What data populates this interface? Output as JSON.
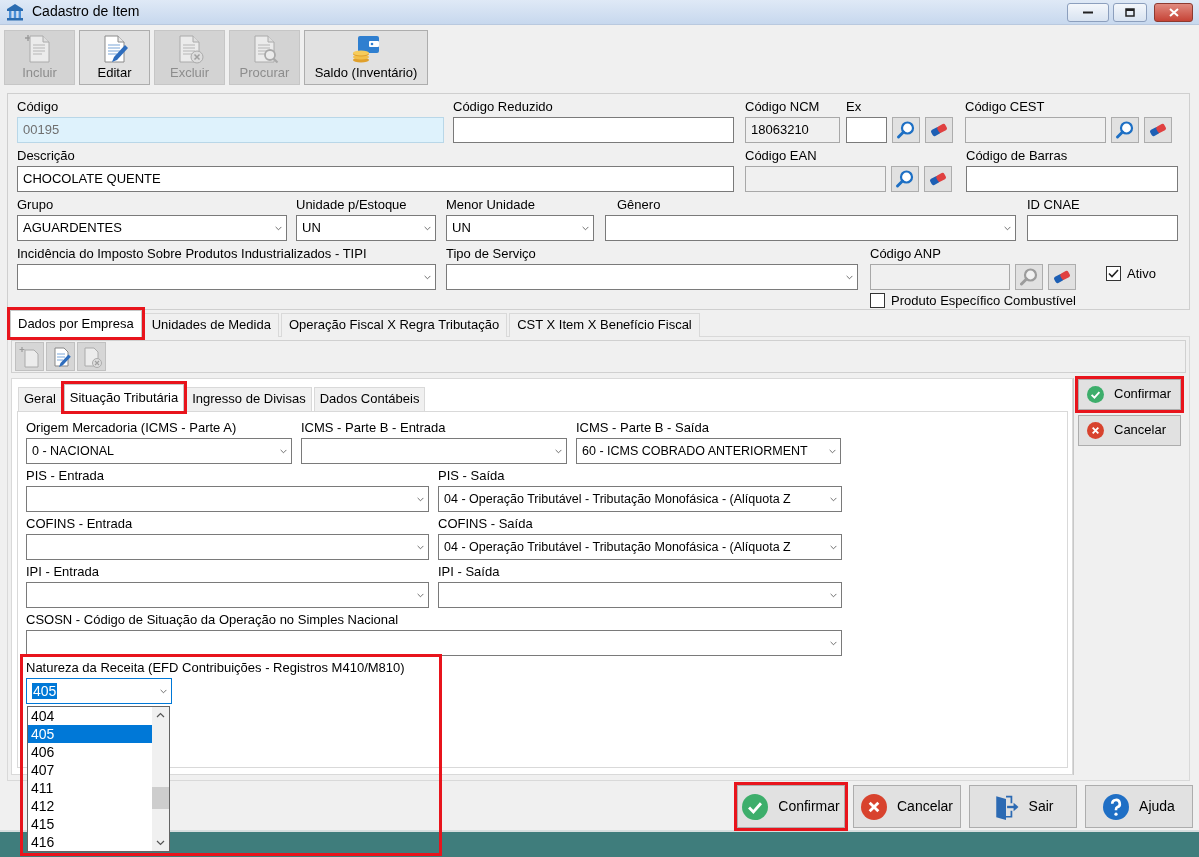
{
  "window": {
    "title": "Cadastro de Item"
  },
  "toolbar": [
    {
      "kind": "add",
      "label": "Incluir",
      "disabled": true
    },
    {
      "kind": "edit",
      "label": "Editar",
      "disabled": false
    },
    {
      "kind": "delete",
      "label": "Excluir",
      "disabled": true
    },
    {
      "kind": "search",
      "label": "Procurar",
      "disabled": true
    },
    {
      "kind": "balance",
      "label": "Saldo (Inventário)",
      "disabled": false
    }
  ],
  "item_form": {
    "fields": [
      {
        "kind": "text",
        "label": "Código",
        "value": "00195",
        "readonly": true,
        "disabled": false
      },
      {
        "kind": "text",
        "label": "Código Reduzido",
        "readonly": false,
        "disabled": false
      },
      {
        "kind": "text",
        "label": "Código NCM",
        "value": "18063210",
        "readonly": false,
        "disabled": true
      },
      {
        "kind": "lookup",
        "label": "Ex",
        "readonly": false,
        "disabled": false,
        "search_disabled": false
      },
      {
        "kind": "lookup",
        "label": "Código CEST",
        "readonly": false,
        "disabled": true,
        "search_disabled": false
      },
      {
        "kind": "text",
        "label": "Descrição",
        "value": "CHOCOLATE QUENTE",
        "readonly": false,
        "disabled": false
      },
      {
        "kind": "lookup",
        "label": "Código EAN",
        "readonly": false,
        "disabled": true,
        "search_disabled": false
      },
      {
        "kind": "text",
        "label": "Código de Barras",
        "readonly": false,
        "disabled": false
      },
      {
        "kind": "select",
        "label": "Grupo",
        "value": "AGUARDENTES"
      },
      {
        "kind": "select",
        "label": "Unidade p/Estoque",
        "value": "UN"
      },
      {
        "kind": "select",
        "label": "Menor Unidade",
        "value": "UN"
      },
      {
        "kind": "select",
        "label": "Gênero"
      },
      {
        "kind": "text",
        "label": "ID CNAE",
        "readonly": false,
        "disabled": false
      },
      {
        "kind": "select",
        "label": "Incidência do Imposto Sobre Produtos Industrializados - TIPI"
      },
      {
        "kind": "select",
        "label": "Tipo de Serviço"
      },
      {
        "kind": "lookup",
        "label": "Código ANP",
        "readonly": false,
        "disabled": true,
        "search_disabled": true
      },
      {
        "kind": "checkbox",
        "label": "Ativo",
        "checked": true
      },
      {
        "kind": "checkbox",
        "label": "Produto Específico Combustível",
        "checked": false
      }
    ]
  },
  "tabs": [
    {
      "label": "Dados por Empresa",
      "selected": true,
      "highlighted": true
    },
    {
      "label": "Unidades de Medida",
      "selected": false,
      "highlighted": false
    },
    {
      "label": "Operação Fiscal X Regra Tributação",
      "selected": false,
      "highlighted": false
    },
    {
      "label": "CST X Item X Benefício Fiscal",
      "selected": false,
      "highlighted": false
    }
  ],
  "sub_toolbar": [
    {
      "kind": "add",
      "disabled": true
    },
    {
      "kind": "edit",
      "disabled": false
    },
    {
      "kind": "delete",
      "disabled": true
    }
  ],
  "subtabs": [
    {
      "label": "Geral",
      "selected": false,
      "highlighted": false
    },
    {
      "label": "Situação Tributária",
      "selected": true,
      "highlighted": true
    },
    {
      "label": "Ingresso de Divisas",
      "selected": false,
      "highlighted": false
    },
    {
      "label": "Dados Contábeis",
      "selected": false,
      "highlighted": false
    }
  ],
  "tax_form": {
    "rows": [
      [
        {
          "kind": "select",
          "label": "Origem Mercadoria (ICMS - Parte A)",
          "value": "0 - NACIONAL"
        },
        {
          "kind": "select",
          "label": "ICMS - Parte B - Entrada"
        },
        {
          "kind": "select",
          "label": "ICMS - Parte B - Saída",
          "value": "60 - ICMS COBRADO ANTERIORMENT"
        }
      ],
      [
        {
          "kind": "select",
          "label": "PIS - Entrada"
        },
        {
          "kind": "select",
          "label": "PIS - Saída",
          "value": "04 - Operação Tributável - Tributação Monofásica - (Alíquota Z"
        }
      ],
      [
        {
          "kind": "select",
          "label": "COFINS - Entrada"
        },
        {
          "kind": "select",
          "label": "COFINS - Saída",
          "value": "04 - Operação Tributável - Tributação Monofásica - (Alíquota Z"
        }
      ],
      [
        {
          "kind": "select",
          "label": "IPI - Entrada"
        },
        {
          "kind": "select",
          "label": "IPI - Saída"
        }
      ],
      [
        {
          "kind": "select",
          "label": "CSOSN - Código de Situação da Operação no Simples Nacional"
        }
      ]
    ],
    "revenue_nature": {
      "label": "Natureza da Receita (EFD Contribuições - Registros M410/M810)",
      "value": "405",
      "expanded": true,
      "highlighted": true,
      "options": [
        {
          "label": "404",
          "selected": false
        },
        {
          "label": "405",
          "selected": true
        },
        {
          "label": "406",
          "selected": false
        },
        {
          "label": "407",
          "selected": false
        },
        {
          "label": "411",
          "selected": false
        },
        {
          "label": "412",
          "selected": false
        },
        {
          "label": "415",
          "selected": false
        },
        {
          "label": "416",
          "selected": false
        }
      ]
    }
  },
  "side_buttons": [
    {
      "kind": "confirm",
      "label": "Confirmar",
      "highlighted": true
    },
    {
      "kind": "cancel",
      "label": "Cancelar",
      "highlighted": false
    }
  ],
  "bottom_buttons": [
    {
      "kind": "confirm",
      "label": "Confirmar",
      "highlighted": true
    },
    {
      "kind": "cancel",
      "label": "Cancelar",
      "highlighted": false
    },
    {
      "kind": "exit",
      "label": "Sair",
      "highlighted": false
    },
    {
      "kind": "help",
      "label": "Ajuda",
      "highlighted": false
    }
  ]
}
